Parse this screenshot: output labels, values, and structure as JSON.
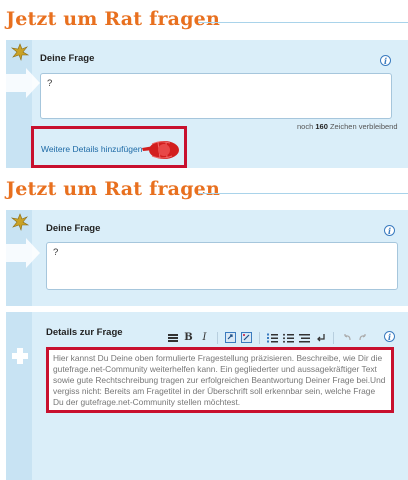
{
  "section_title": "Jetzt um Rat fragen",
  "top": {
    "question_label": "Deine Frage",
    "question_value": "?",
    "counter_prefix": "noch",
    "counter_value": "160",
    "counter_suffix": "Zeichen verbleibend",
    "details_link": "Weitere Details hinzufügen"
  },
  "bottom": {
    "question_label": "Deine Frage",
    "question_value": "?",
    "details_label": "Details zur Frage",
    "details_placeholder": "Hier kannst Du Deine oben formulierte Fragestellung präzisieren. Beschreibe, wie Dir die gutefrage.net-Community weiterhelfen kann. Ein gegliederter und aussagekräftiger Text sowie gute Rechtschreibung tragen zur erfolgreichen Beantwortung Deiner Frage bei.Und vergiss nicht: Bereits am Fragetitel in der Überschrift soll erkennbar sein, welche Frage Du der gutefrage.net-Community stellen möchtest.",
    "toolbar": {
      "bold": "B",
      "italic": "I"
    }
  },
  "info_glyph": "i",
  "icons": [
    "leaf-icon",
    "arrow-icon",
    "plus-icon",
    "info-icon",
    "hand-pointer-icon",
    "format-icon",
    "bold-icon",
    "italic-icon",
    "link-icon",
    "unlink-icon",
    "ordered-list-icon",
    "unordered-list-icon",
    "align-icon",
    "linebreak-icon",
    "undo-icon",
    "redo-icon"
  ],
  "colors": {
    "accent": "#e8701f",
    "panel": "#daeef9",
    "highlight": "#c8102e",
    "link": "#1d6aa6"
  }
}
